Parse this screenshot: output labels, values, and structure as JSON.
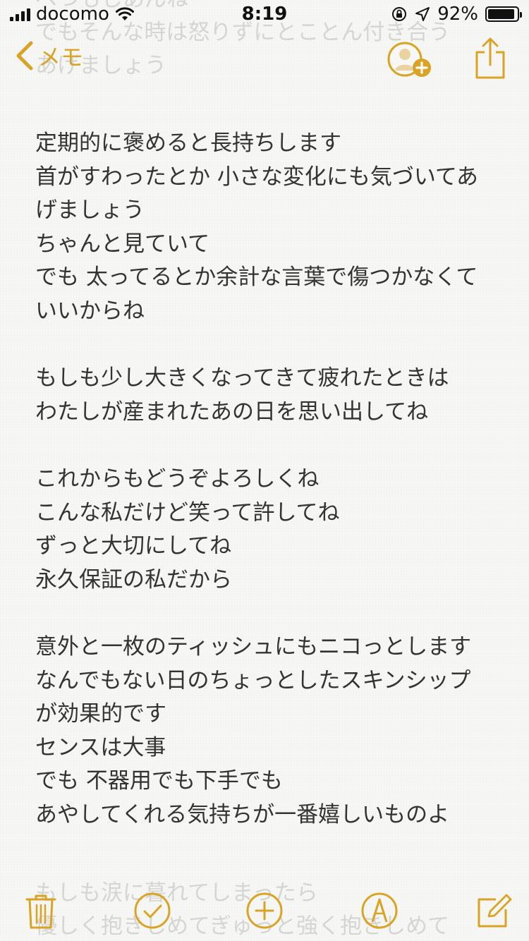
{
  "status_bar": {
    "carrier": "docomo",
    "time": "8:19",
    "battery_percent_label": "92%",
    "battery_level": 0.92
  },
  "nav": {
    "back_label": "メモ"
  },
  "ghost_top": [
    "ベつもしあんね",
    "でもそんな時は怒りずにとことん付き合う",
    "あげましょう"
  ],
  "note": {
    "lines": [
      "定期的に褒めると長持ちします",
      "首がすわったとか 小さな変化にも気づいてあ",
      "げましょう",
      "ちゃんと見ていて",
      "でも 太ってるとか余計な言葉で傷つかなくて",
      "いいからね",
      "",
      "もしも少し大きくなってきて疲れたときは",
      "わたしが産まれたあの日を思い出してね",
      "",
      "これからもどうぞよろしくね",
      "こんな私だけど笑って許してね",
      "ずっと大切にしてね",
      "永久保証の私だから",
      "",
      "意外と一枚のティッシュにもニコっとします",
      "なんでもない日のちょっとしたスキンシップ",
      "が効果的です",
      "センスは大事",
      "でも 不器用でも下手でも",
      "あやしてくれる気持ちが一番嬉しいものよ"
    ]
  },
  "ghost_bottom": [
    "もしも涙に暮れてしまったら",
    "優しく抱きしめてぎゅっと強く抱きしめて"
  ],
  "colors": {
    "accent": "#d9a426",
    "text": "#333333",
    "background": "#f7f7f5"
  },
  "icons": {
    "back": "chevron-left-icon",
    "add_person": "add-person-icon",
    "share": "share-icon",
    "trash": "trash-icon",
    "checklist": "checkmark-circle-icon",
    "add": "plus-circle-icon",
    "sketch": "pen-circle-icon",
    "compose": "compose-icon"
  }
}
